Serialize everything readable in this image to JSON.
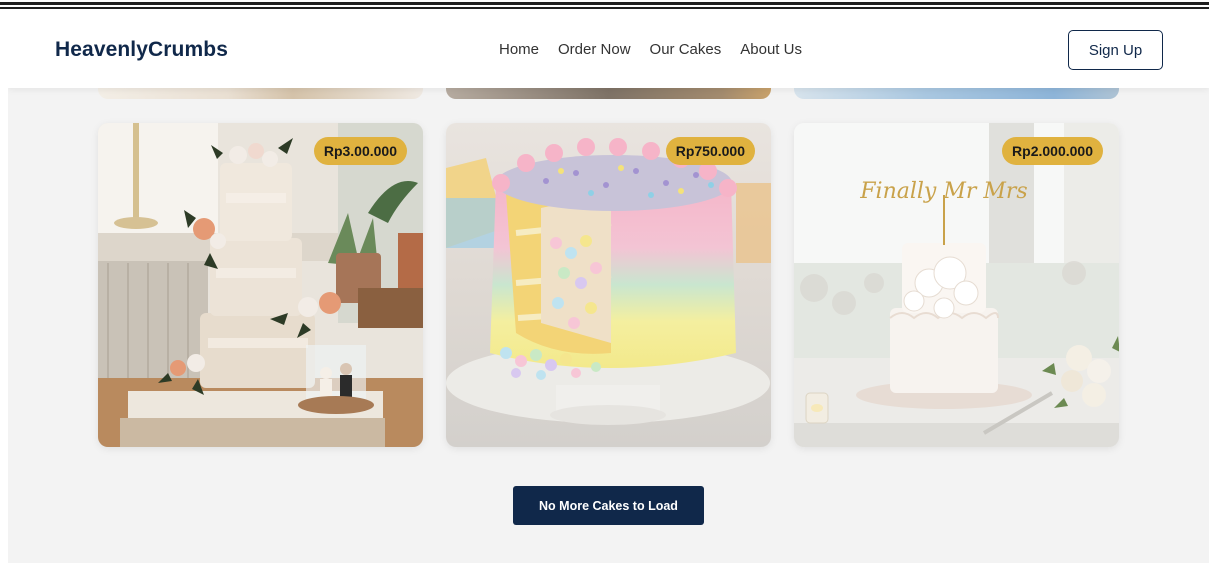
{
  "brand": "HeavenlyCrumbs",
  "nav": {
    "items": [
      {
        "label": "Home"
      },
      {
        "label": "Order Now"
      },
      {
        "label": "Our Cakes"
      },
      {
        "label": "About Us"
      }
    ],
    "signup_label": "Sign Up"
  },
  "cakes": [
    {
      "price": "Rp3.00.000",
      "image": "naked-wedding-cake-with-flowers"
    },
    {
      "price": "Rp750.000",
      "image": "pastel-rainbow-surprise-cake"
    },
    {
      "price": "Rp2.000.000",
      "image": "white-floral-wedding-cake"
    }
  ],
  "cake_topper_text": "Finally Mr Mrs",
  "load_more_label": "No More Cakes to Load",
  "colors": {
    "navy": "#10284a",
    "price_badge": "#e0b23f",
    "background": "#f3f3f3"
  }
}
